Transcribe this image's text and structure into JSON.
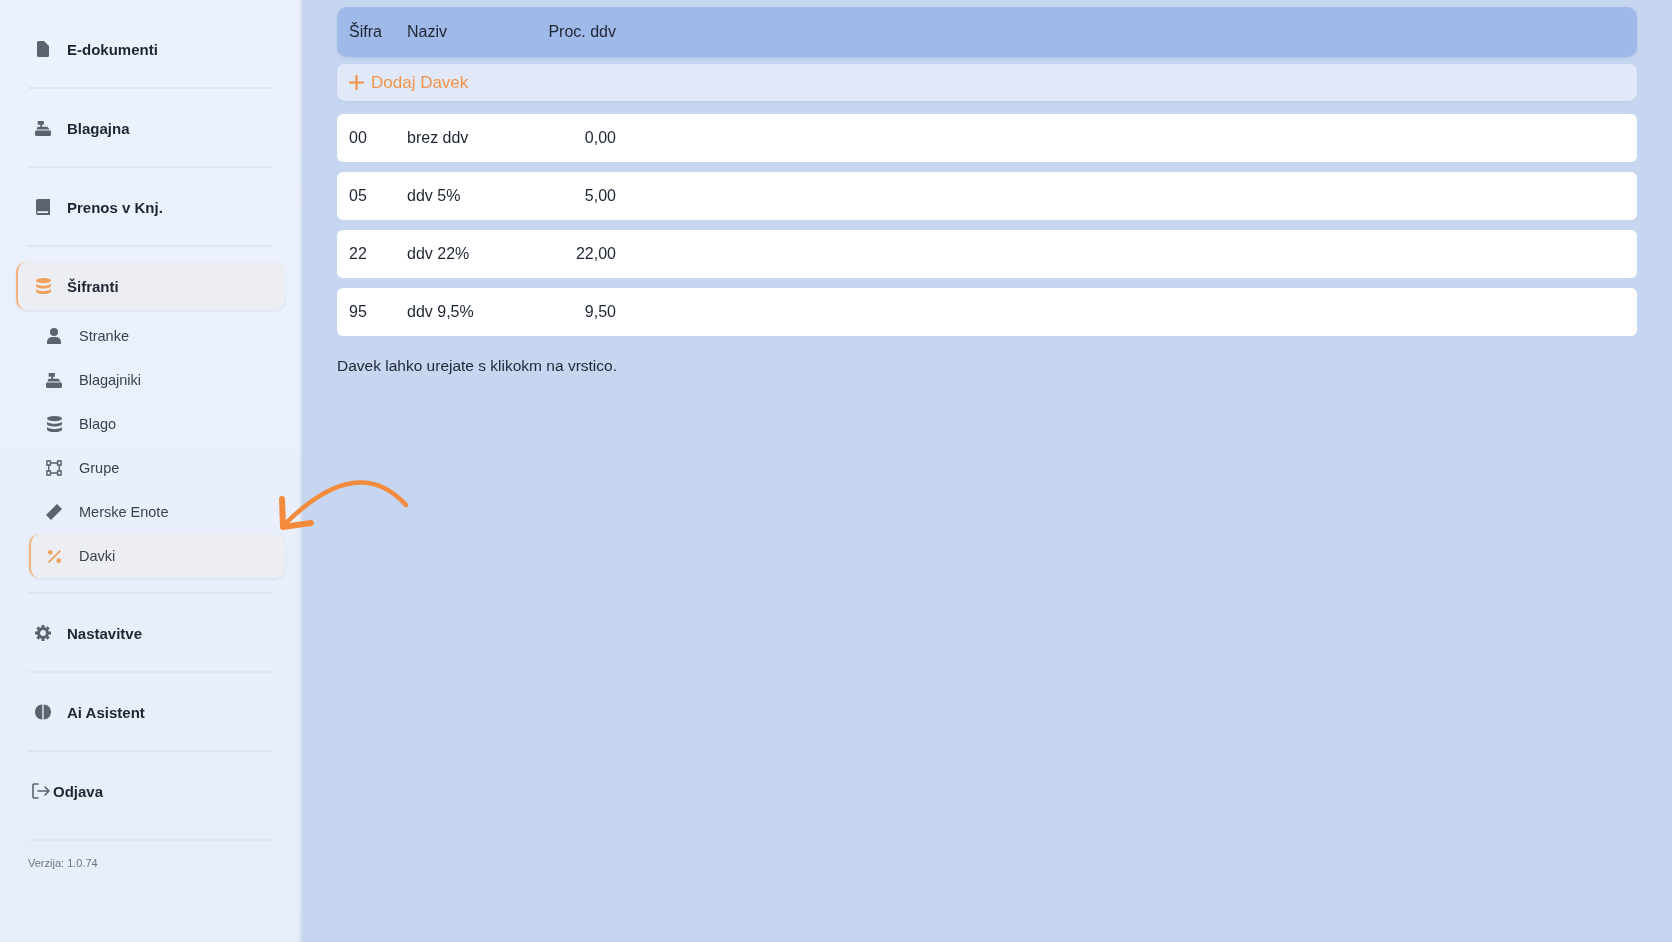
{
  "sidebar": {
    "items": [
      {
        "kind": "nav",
        "label": "E-dokumenti",
        "selected": false
      },
      {
        "kind": "nav",
        "label": "Blagajna",
        "selected": false
      },
      {
        "kind": "nav",
        "label": "Prenos v Knj.",
        "selected": false
      },
      {
        "kind": "nav",
        "label": "Šifranti",
        "selected": true,
        "children": [
          {
            "label": "Stranke",
            "selected": false
          },
          {
            "label": "Blagajniki",
            "selected": false
          },
          {
            "label": "Blago",
            "selected": false
          },
          {
            "label": "Grupe",
            "selected": false
          },
          {
            "label": "Merske Enote",
            "selected": false
          },
          {
            "label": "Davki",
            "selected": true
          }
        ]
      },
      {
        "kind": "nav",
        "label": "Nastavitve",
        "selected": false
      },
      {
        "kind": "nav",
        "label": "Ai Asistent",
        "selected": false
      },
      {
        "kind": "logout",
        "label": "Odjava",
        "selected": false
      }
    ],
    "version": "Verzija: 1.0.74"
  },
  "table": {
    "columns": [
      "Šifra",
      "Naziv",
      "Proc. ddv"
    ],
    "add_button": {
      "label": "Dodaj Davek"
    },
    "rows": [
      {
        "cells": [
          "00",
          "brez ddv",
          "0,00"
        ]
      },
      {
        "cells": [
          "05",
          "ddv 5%",
          "5,00"
        ]
      },
      {
        "cells": [
          "22",
          "ddv 22%",
          "22,00"
        ]
      },
      {
        "cells": [
          "95",
          "ddv 9,5%",
          "9,50"
        ]
      }
    ]
  },
  "hint": "Davek lahko urejate s klikokm na vrstico."
}
